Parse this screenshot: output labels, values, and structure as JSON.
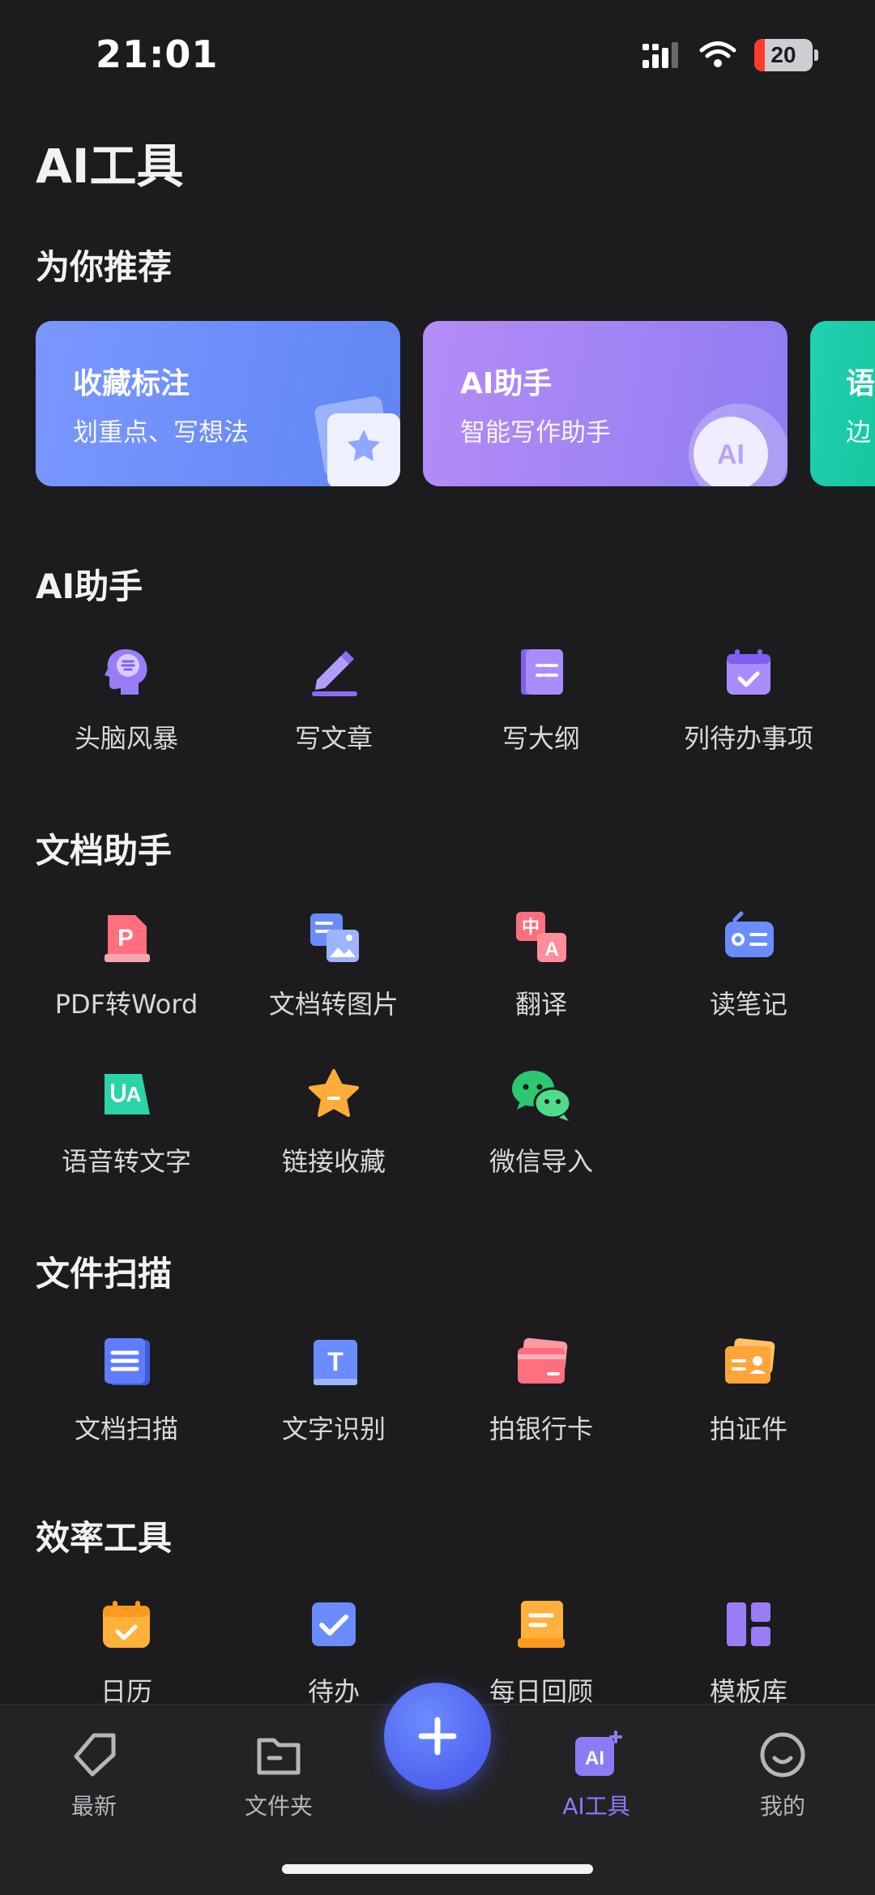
{
  "status": {
    "time": "21:01",
    "battery": "20"
  },
  "page_title": "AI工具",
  "recommend": {
    "title": "为你推荐",
    "cards": [
      {
        "title": "收藏标注",
        "subtitle": "划重点、写想法",
        "icon": "star-card-icon"
      },
      {
        "title": "AI助手",
        "subtitle": "智能写作助手",
        "icon": "ai-badge-icon",
        "badge": "AI"
      },
      {
        "title": "语",
        "subtitle": "边"
      }
    ]
  },
  "ai_assistant": {
    "title": "AI助手",
    "items": [
      {
        "label": "头脑风暴",
        "icon": "brain-icon"
      },
      {
        "label": "写文章",
        "icon": "pen-icon"
      },
      {
        "label": "写大纲",
        "icon": "outline-icon"
      },
      {
        "label": "列待办事项",
        "icon": "todo-calendar-icon"
      }
    ]
  },
  "doc_assistant": {
    "title": "文档助手",
    "items": [
      {
        "label": "PDF转Word",
        "icon": "pdf-icon",
        "glyph": "P"
      },
      {
        "label": "文档转图片",
        "icon": "doc-to-image-icon"
      },
      {
        "label": "翻译",
        "icon": "translate-icon",
        "glyph": "中",
        "glyph2": "A"
      },
      {
        "label": "读笔记",
        "icon": "radio-icon"
      },
      {
        "label": "语音转文字",
        "icon": "voice-to-text-icon",
        "glyph": "A"
      },
      {
        "label": "链接收藏",
        "icon": "link-star-icon"
      },
      {
        "label": "微信导入",
        "icon": "wechat-icon"
      }
    ]
  },
  "file_scan": {
    "title": "文件扫描",
    "items": [
      {
        "label": "文档扫描",
        "icon": "doc-scan-icon"
      },
      {
        "label": "文字识别",
        "icon": "text-recognition-icon",
        "glyph": "T"
      },
      {
        "label": "拍银行卡",
        "icon": "bank-card-icon"
      },
      {
        "label": "拍证件",
        "icon": "id-card-icon"
      }
    ]
  },
  "efficiency": {
    "title": "效率工具",
    "items": [
      {
        "label": "日历",
        "icon": "calendar-icon"
      },
      {
        "label": "待办",
        "icon": "checkbox-icon"
      },
      {
        "label": "每日回顾",
        "icon": "daily-review-icon"
      },
      {
        "label": "模板库",
        "icon": "template-icon"
      }
    ]
  },
  "nav": {
    "items": [
      {
        "label": "最新",
        "icon": "tag-icon"
      },
      {
        "label": "文件夹",
        "icon": "folder-icon"
      },
      {
        "label": "AI工具",
        "icon": "ai-tools-icon",
        "badge": "AI"
      },
      {
        "label": "我的",
        "icon": "smile-icon"
      }
    ],
    "active": "AI工具",
    "fab_icon": "plus-icon"
  },
  "colors": {
    "accent": "#8b7cf6",
    "background": "#1c1c1e",
    "fab": "#5566f0"
  }
}
